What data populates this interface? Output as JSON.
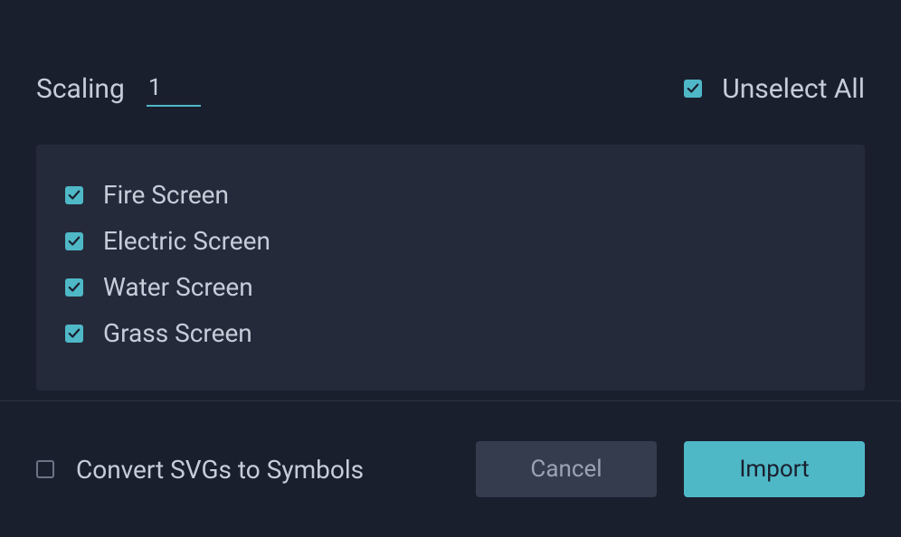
{
  "scaling": {
    "label": "Scaling",
    "value": "1"
  },
  "unselectAll": {
    "label": "Unselect All",
    "checked": true
  },
  "items": [
    {
      "label": "Fire Screen",
      "checked": true
    },
    {
      "label": "Electric Screen",
      "checked": true
    },
    {
      "label": "Water Screen",
      "checked": true
    },
    {
      "label": "Grass Screen",
      "checked": true
    }
  ],
  "convertSvgs": {
    "label": "Convert SVGs to Symbols",
    "checked": false
  },
  "buttons": {
    "cancel": "Cancel",
    "import": "Import"
  }
}
